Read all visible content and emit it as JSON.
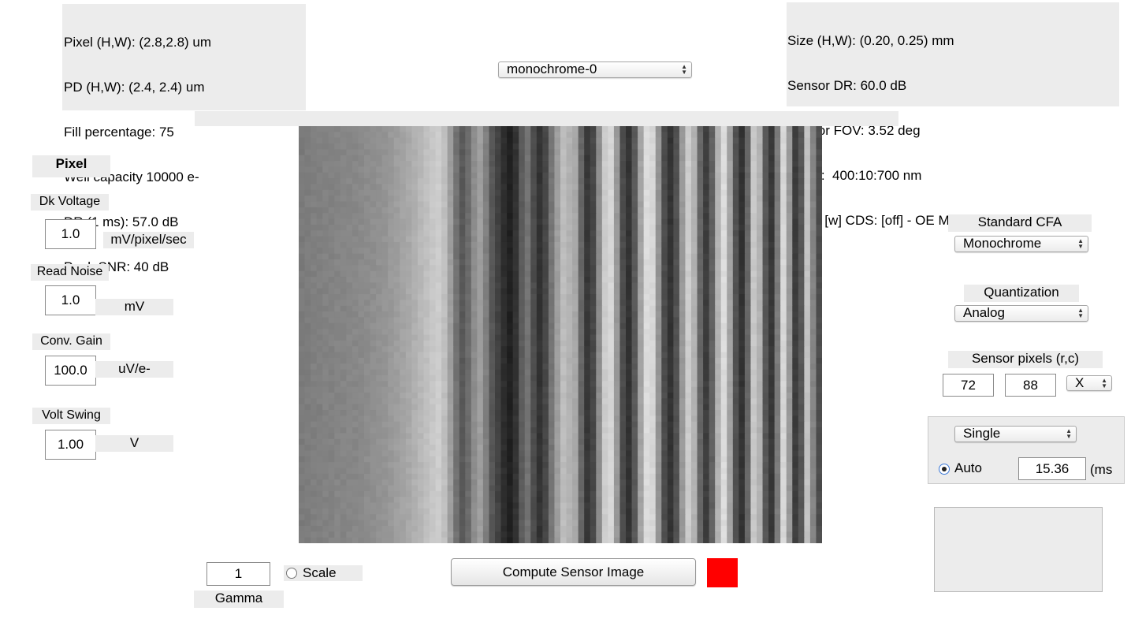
{
  "left_info": {
    "lines": [
      "Pixel (H,W): (2.8,2.8) um",
      "PD (H,W): (2.4, 2.4) um",
      "Fill percentage: 75",
      "Well capacity 10000 e-",
      "DR (1 ms): 57.0 dB",
      "Peak SNR: 40 dB"
    ]
  },
  "right_info": {
    "lines": [
      "Size (H,W): (0.20, 0.25) mm",
      "Sensor DR: 60.0 dB",
      "Sensor FOV: 3.52 deg",
      "Wave:  400:10:700 nm",
      "CFA:  [w] CDS: [off] - OE Method: [skip]"
    ]
  },
  "sensor_select": {
    "value": "monochrome-0"
  },
  "pixel_panel": {
    "title": "Pixel",
    "dk_voltage": {
      "label": "Dk Voltage",
      "value": "1.0",
      "unit": "mV/pixel/sec"
    },
    "read_noise": {
      "label": "Read Noise",
      "value": "1.0",
      "unit": "mV"
    },
    "conv_gain": {
      "label": "Conv. Gain",
      "value": "100.0",
      "unit": "uV/e-"
    },
    "volt_swing": {
      "label": "Volt Swing",
      "value": "1.00",
      "unit": "V"
    }
  },
  "cfa": {
    "label": "Standard CFA",
    "value": "Monochrome"
  },
  "quantization": {
    "label": "Quantization",
    "value": "Analog"
  },
  "sensor_pixels": {
    "label": "Sensor pixels  (r,c)",
    "rows": "72",
    "cols": "88",
    "mode": "X"
  },
  "exposure": {
    "mode": "Single",
    "auto_label": "Auto",
    "auto_checked": true,
    "time": "15.36",
    "unit": "(ms"
  },
  "gamma": {
    "value": "1",
    "label": "Gamma"
  },
  "scale": {
    "label": "Scale",
    "checked": false
  },
  "compute_button": {
    "label": "Compute Sensor  Image"
  },
  "colors": {
    "status_indicator": "#ff0000",
    "panel": "#ececec"
  },
  "image": {
    "rows": 72,
    "cols": 88,
    "column_profile": [
      0.48,
      0.49,
      0.5,
      0.5,
      0.51,
      0.51,
      0.52,
      0.52,
      0.53,
      0.53,
      0.54,
      0.55,
      0.56,
      0.57,
      0.58,
      0.6,
      0.62,
      0.64,
      0.66,
      0.69,
      0.72,
      0.75,
      0.78,
      0.8,
      0.75,
      0.62,
      0.45,
      0.35,
      0.42,
      0.55,
      0.62,
      0.5,
      0.34,
      0.26,
      0.18,
      0.13,
      0.2,
      0.36,
      0.45,
      0.3,
      0.2,
      0.28,
      0.46,
      0.62,
      0.74,
      0.7,
      0.66,
      0.4,
      0.22,
      0.28,
      0.55,
      0.8,
      0.84,
      0.6,
      0.3,
      0.2,
      0.35,
      0.64,
      0.86,
      0.84,
      0.58,
      0.3,
      0.2,
      0.32,
      0.6,
      0.8,
      0.7,
      0.4,
      0.24,
      0.38,
      0.7,
      0.86,
      0.64,
      0.32,
      0.2,
      0.4,
      0.78,
      0.7,
      0.34,
      0.22,
      0.48,
      0.84,
      0.6,
      0.24,
      0.34,
      0.76,
      0.52,
      0.3
    ]
  }
}
